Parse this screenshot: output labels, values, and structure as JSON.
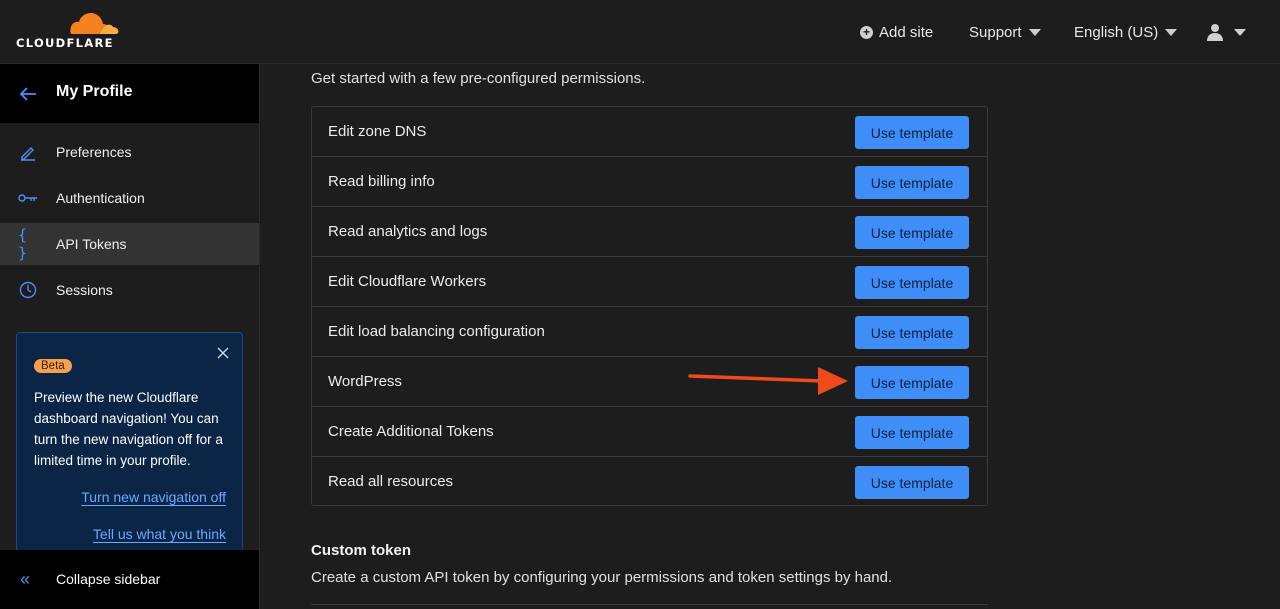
{
  "brand": {
    "name": "CLOUDFLARE",
    "accent": "#f6821f"
  },
  "topbar": {
    "add_site": "Add site",
    "support": "Support",
    "language": "English (US)"
  },
  "sidebar": {
    "title": "My Profile",
    "items": [
      {
        "label": "Preferences",
        "icon": "pencil-icon"
      },
      {
        "label": "Authentication",
        "icon": "key-icon"
      },
      {
        "label": "API Tokens",
        "icon": "braces-icon",
        "active": true
      },
      {
        "label": "Sessions",
        "icon": "clock-icon"
      }
    ],
    "beta": {
      "badge": "Beta",
      "text": "Preview the new Cloudflare dashboard navigation! You can turn the new navigation off for a limited time in your profile.",
      "link1": "Turn new navigation off",
      "link2": "Tell us what you think"
    },
    "collapse": "Collapse sidebar"
  },
  "main": {
    "intro": "Get started with a few pre-configured permissions.",
    "templates": [
      {
        "name": "Edit zone DNS",
        "button": "Use template"
      },
      {
        "name": "Read billing info",
        "button": "Use template"
      },
      {
        "name": "Read analytics and logs",
        "button": "Use template"
      },
      {
        "name": "Edit Cloudflare Workers",
        "button": "Use template"
      },
      {
        "name": "Edit load balancing configuration",
        "button": "Use template"
      },
      {
        "name": "WordPress",
        "button": "Use template"
      },
      {
        "name": "Create Additional Tokens",
        "button": "Use template"
      },
      {
        "name": "Read all resources",
        "button": "Use template"
      }
    ],
    "custom": {
      "title": "Custom token",
      "description": "Create a custom API token by configuring your permissions and token settings by hand."
    }
  },
  "colors": {
    "button": "#3f8ef8",
    "annotation_arrow": "#f04a1a",
    "link": "#6aa7ff"
  }
}
